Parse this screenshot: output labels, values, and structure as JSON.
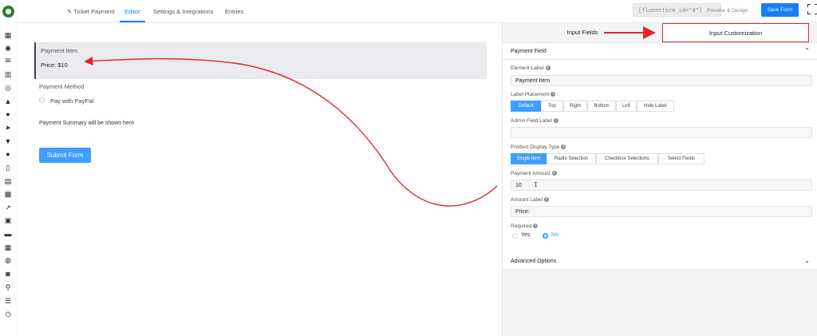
{
  "sidebar": {
    "icons": [
      "dashboard-icon",
      "eye-icon",
      "envelope-icon",
      "bar-chart-icon",
      "whatsapp-icon",
      "graduation-cap-icon",
      "users-icon",
      "send-icon",
      "filter-icon",
      "globe-icon",
      "file-icon",
      "document-icon",
      "table-icon",
      "line-chart-icon",
      "store-icon",
      "archive-icon",
      "calendar-icon",
      "palette-icon",
      "chat-icon",
      "search-icon",
      "sliders-icon",
      "power-icon"
    ],
    "glyphs": [
      "▦",
      "◉",
      "✉",
      "▥",
      "◎",
      "▲",
      "●",
      "➤",
      "▼",
      "●",
      "▯",
      "▤",
      "▩",
      "↗",
      "▣",
      "▬",
      "▦",
      "◍",
      "◙",
      "⚲",
      "☰",
      "⏻"
    ]
  },
  "topbar": {
    "nav": [
      "Ticket Payment",
      "Editor",
      "Settings & Integrations",
      "Entries"
    ],
    "shortcode": "[fluentform id=\"4\"]",
    "preview": "Preview & Design",
    "save": "Save Form"
  },
  "canvas": {
    "payment_item_label": "Payment Item",
    "price_text": "Price: $10",
    "payment_method_label": "Payment Method",
    "payment_option": "Pay with PayPal",
    "summary": "Payment Summary will be shown here",
    "submit": "Submit Form"
  },
  "panel": {
    "tabs": [
      "Input Fields",
      "Input Customization"
    ],
    "section_title": "Payment Field",
    "element_label": {
      "label": "Element Label",
      "value": "Payment Item"
    },
    "label_placement": {
      "label": "Label Placement",
      "options": [
        "Default",
        "Top",
        "Right",
        "Bottom",
        "Left",
        "Hide Label"
      ],
      "selected": "Default"
    },
    "admin_label": {
      "label": "Admin Field Label",
      "value": ""
    },
    "display_type": {
      "label": "Product Display Type",
      "options": [
        "Single Item",
        "Radio Selection",
        "Checkbox Selections",
        "Select Fields"
      ],
      "selected": "Single Item"
    },
    "payment_amount": {
      "label": "Payment Amount",
      "value": "10"
    },
    "amount_label": {
      "label": "Amount Label",
      "value": "Price:"
    },
    "required": {
      "label": "Required",
      "options": [
        "Yes",
        "No"
      ],
      "selected": "No"
    },
    "advanced": "Advanced Options"
  },
  "colors": {
    "accent": "#1a7efb",
    "annotation": "#e0282e"
  }
}
